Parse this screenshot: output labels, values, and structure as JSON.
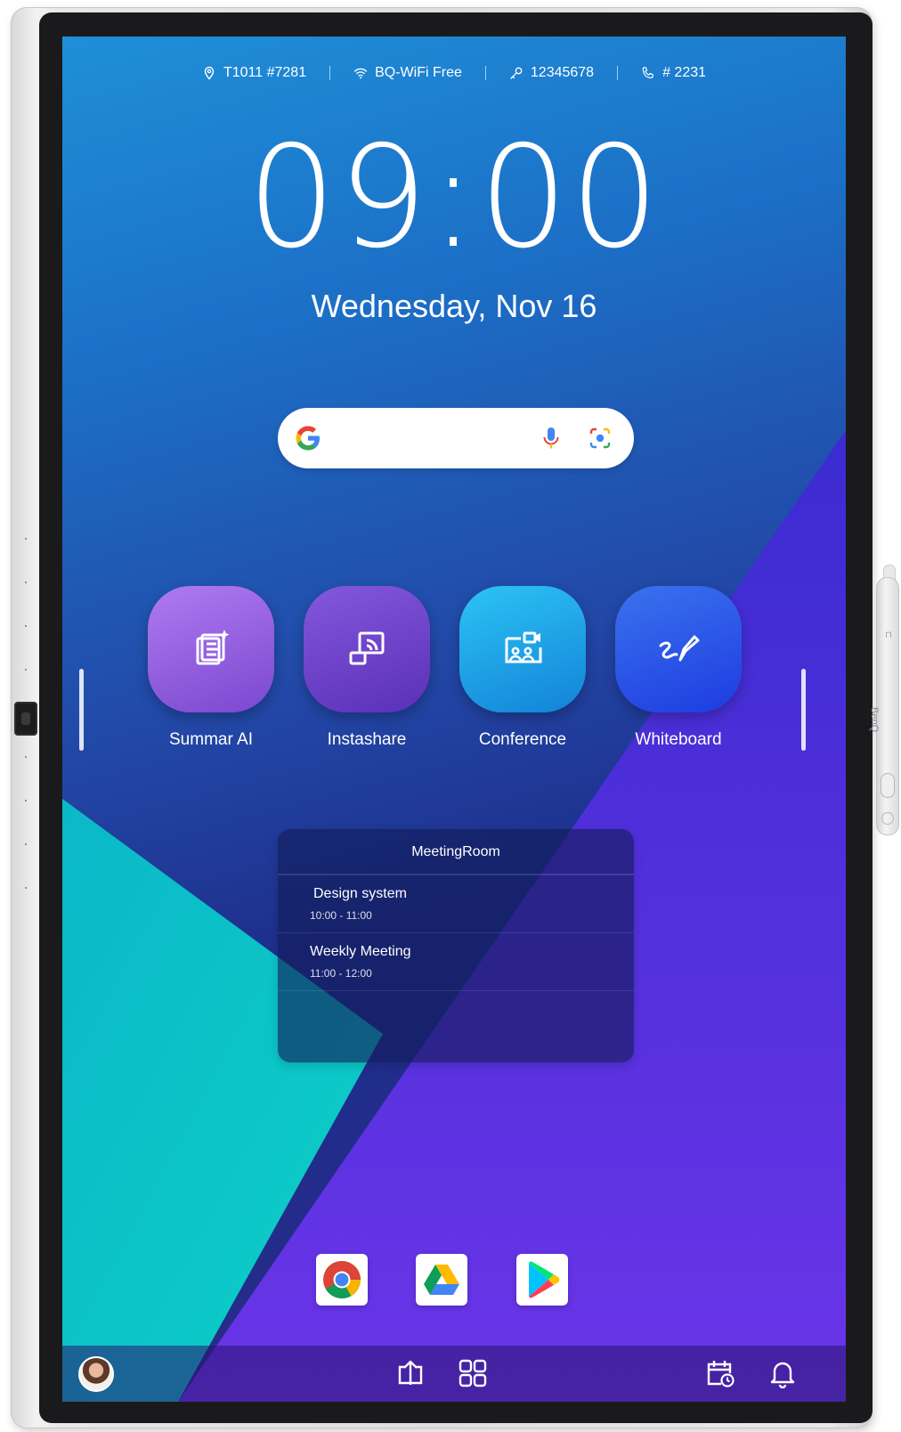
{
  "status_bar": {
    "room": "T1011 #7281",
    "wifi": "BQ-WiFi Free",
    "password": "12345678",
    "extension": "# 2231"
  },
  "clock": {
    "time": "09:00",
    "date": "Wednesday, Nov 16"
  },
  "search": {
    "logo_icon": "google-g-icon",
    "voice_icon": "microphone-icon",
    "lens_icon": "camera-lens-icon"
  },
  "apps": [
    {
      "label": "Summar AI",
      "icon": "ai-notes-icon",
      "color": "#8a5ad8"
    },
    {
      "label": "Instashare",
      "icon": "screen-cast-icon",
      "color": "#6a3cc6"
    },
    {
      "label": "Conference",
      "icon": "video-conference-icon",
      "color": "#1a9ae6"
    },
    {
      "label": "Whiteboard",
      "icon": "pen-draw-icon",
      "color": "#2a5ae8"
    }
  ],
  "meeting": {
    "title": "MeetingRoom",
    "events": [
      {
        "name": "Design system",
        "time": "10:00 - 11:00"
      },
      {
        "name": "Weekly Meeting",
        "time": "11:00 - 12:00"
      }
    ]
  },
  "dock": [
    {
      "icon": "chrome-icon"
    },
    {
      "icon": "google-drive-icon"
    },
    {
      "icon": "google-play-icon"
    }
  ],
  "taskbar": {
    "left": [
      "avatar"
    ],
    "center": [
      "screen-share-upload-icon",
      "app-grid-icon"
    ],
    "right": [
      "calendar-clock-icon",
      "bell-icon"
    ]
  },
  "device": {
    "brand": "BenQ"
  },
  "colors": {
    "teal": "#0bc4c4",
    "violet": "#5a3ae0",
    "blue": "#1e6fc8"
  }
}
